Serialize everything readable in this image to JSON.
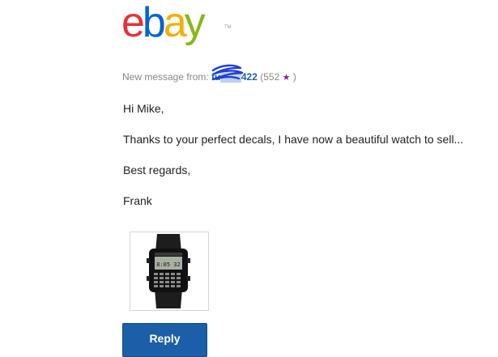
{
  "logo": {
    "letters": [
      "e",
      "b",
      "a",
      "y"
    ],
    "tm": "TM"
  },
  "header": {
    "prefix": "New message from: ",
    "username": "fu▒▒▒422",
    "feedback_open": "(552 ",
    "feedback_close": " )",
    "star_icon": "purple-star-icon"
  },
  "message": {
    "greeting": "Hi Mike,",
    "body": "Thanks to your perfect decals, I have now a beautiful watch to sell...",
    "closing": "Best regards,",
    "signature": "Frank"
  },
  "attachment": {
    "watch_display": "8:05 32"
  },
  "actions": {
    "reply_label": "Reply"
  },
  "colors": {
    "ebay_red": "#e53238",
    "ebay_blue": "#0064d2",
    "ebay_yellow": "#f5af02",
    "ebay_green": "#86b817",
    "link_blue": "#1a5fb4",
    "button_blue": "#1c5fa8"
  }
}
